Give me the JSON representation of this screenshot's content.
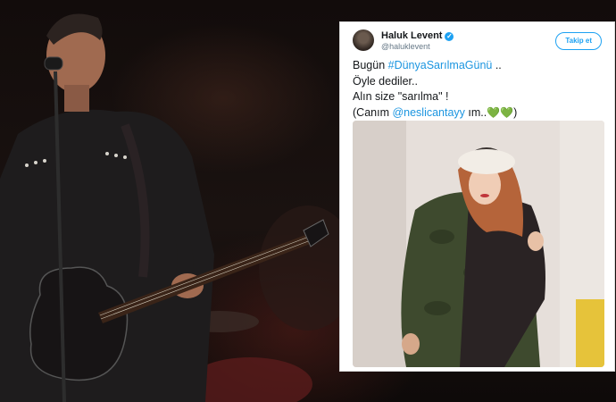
{
  "tweet": {
    "display_name": "Haluk Levent",
    "verified_glyph": "✓",
    "handle": "@haluklevent",
    "follow_label": "Takip et",
    "line1_prefix": "Bugün ",
    "line1_hashtag": "#DünyaSarılmaGünü",
    "line1_suffix": " ..",
    "line2": "Öyle dediler..",
    "line3": "Alın size \"sarılma\" !",
    "line4_prefix": "(Canım ",
    "line4_mention": "@neslicantayy",
    "line4_suffix": " ım..",
    "hearts": "💚💚",
    "line4_close": ")"
  },
  "icons": {
    "avatar": "avatar-image",
    "verified": "verified-badge-icon",
    "hearts": "green-heart-icon"
  },
  "colors": {
    "link": "#1b95e0",
    "follow": "#1da1f2",
    "heart": "#4caf3a"
  }
}
